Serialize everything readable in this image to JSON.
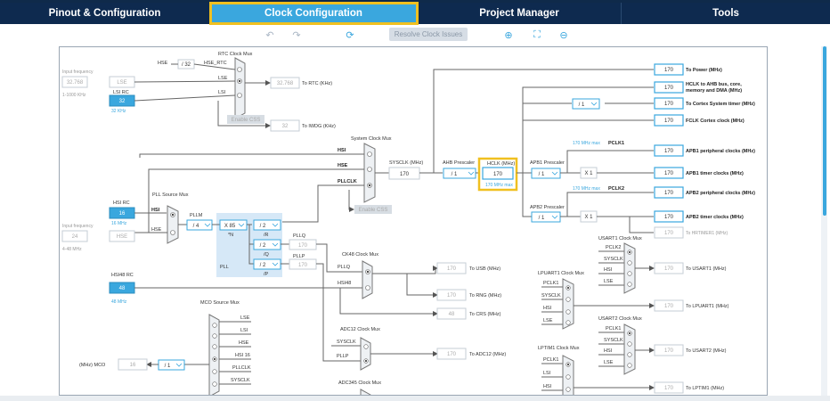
{
  "tabs": [
    "Pinout & Configuration",
    "Clock Configuration",
    "Project Manager",
    "Tools"
  ],
  "toolbar": {
    "resolve_label": "Resolve Clock Issues"
  },
  "diagram": {
    "input_freq_label": "Input frequency",
    "lse_value": "32.768",
    "lse_range": "1-1000 KHz",
    "lse_label": "LSE",
    "lsi_rc_label": "LSI RC",
    "lsi_value": "32",
    "lsi_unit": "32 KHz",
    "hse_label": "HSE",
    "div32": "/ 32",
    "hse_rtc": "HSE_RTC",
    "rtc_mux": "RTC Clock Mux",
    "lse_line": "LSE",
    "lsi_line": "LSI",
    "rtc_value": "32.768",
    "to_rtc": "To RTC (KHz)",
    "enable_css": "Enable CSS",
    "iwdg_value": "32",
    "to_iwdg": "To IWDG (KHz)",
    "sys_mux": "System Clock Mux",
    "hsi": "HSI",
    "hse": "HSE",
    "pllclk": "PLLCLK",
    "sysclk_label": "SYSCLK (MHz)",
    "sysclk_value": "170",
    "ahb_label": "AHB Prescaler",
    "ahb_value": "/ 1",
    "hclk_label": "HCLK (MHz)",
    "hclk_value": "170",
    "hclk_max": "170 MHz max",
    "enable_css2": "Enable CSS",
    "hsi_rc_label": "HSI RC",
    "hsi_value": "16",
    "hsi_unit": "16 MHz",
    "pll_src_mux": "PLL Source Mux",
    "pllm_label": "PLLM",
    "pllm_value": "/ 4",
    "x85": "X 85",
    "n_label": "*N",
    "pll_label": "PLL",
    "div2a": "/ 2",
    "r_label": "/R",
    "div2b": "/ 2",
    "q_label": "/Q",
    "div2c": "/ 2",
    "p_label": "/P",
    "pllq_label": "PLLQ",
    "pllq_value": "170",
    "pllp_label": "PLLP",
    "pllp_value": "170",
    "hse_input_freq": "Input frequency",
    "hse_value": "24",
    "hse_range": "4-48 MHz",
    "hse_box": "HSE",
    "hsi48_rc": "HSI48 RC",
    "hsi48_value": "48",
    "hsi48_unit": "48 MHz",
    "ck48_mux": "CK48 Clock Mux",
    "pllq_in": "PLLQ",
    "hsi48_in": "HSI48",
    "usb_value": "170",
    "to_usb": "To USB (MHz)",
    "rng_value": "170",
    "to_rng": "To RNG (MHz)",
    "crs_value": "48",
    "to_crs": "To CRS (MHz)",
    "mco_mux": "MCO Source Mux",
    "mco_lse": "LSE",
    "mco_lsi": "LSI",
    "mco_hse": "HSE",
    "mco_hsi16": "HSI 16",
    "mco_pllclk": "PLLCLK",
    "mco_sysclk": "SYSCLK",
    "mco_label": "(MHz) MCO",
    "mco_value": "16",
    "mco_div": "/ 1",
    "adc12_mux": "ADC12 Clock Mux",
    "adc_sysclk": "SYSCLK",
    "adc_pllp": "PLLP",
    "adc12_value": "170",
    "to_adc12": "To ADC12 (MHz)",
    "adc345_mux": "ADC345 Clock Mux",
    "to_power_value": "170",
    "to_power": "To Power (MHz)",
    "hclk_ahb_value": "170",
    "hclk_ahb": "HCLK to AHB bus, core,",
    "hclk_ahb2": "memory and DMA (MHz)",
    "systimer_div": "/ 1",
    "systimer_value": "170",
    "to_systimer": "To Cortex System timer (MHz)",
    "fclk_value": "170",
    "fclk": "FCLK Cortex clock (MHz)",
    "apb1_label": "APB1 Prescaler",
    "apb1_div": "/ 1",
    "apb1_max": "170 MHz max",
    "pclk1": "PCLK1",
    "apb1_periph_value": "170",
    "apb1_periph": "APB1 peripheral clocks (MHz)",
    "x1a": "X 1",
    "apb1_timer_value": "170",
    "apb1_timer": "APB1 timer clocks (MHz)",
    "apb2_max": "170 MHz max",
    "pclk2": "PCLK2",
    "apb2_periph_value": "170",
    "apb2_periph": "APB2 peripheral clocks (MHz)",
    "apb2_label": "APB2 Prescaler",
    "apb2_div": "/ 1",
    "x1b": "X 1",
    "apb2_timer_value": "170",
    "apb2_timer": "APB2 timer clocks (MHz)",
    "hrtim_value": "170",
    "to_hrtim": "To HRTIMER1 (MHz)",
    "usart1_mux": "USART1 Clock Mux",
    "u1_pclk2": "PCLK2",
    "u1_sysclk": "SYSCLK",
    "u1_hsi": "HSI",
    "u1_lse": "LSE",
    "usart1_value": "170",
    "to_usart1": "To USART1 (MHz)",
    "lpuart1_mux": "LPUART1 Clock Mux",
    "lp_pclk1": "PCLK1",
    "lp_sysclk": "SYSCLK",
    "lp_hsi": "HSI",
    "lp_lse": "LSE",
    "lpuart1_value": "170",
    "to_lpuart1": "To LPUART1 (MHz)",
    "usart2_mux": "USART2 Clock Mux",
    "u2_pclk1": "PCLK1",
    "u2_sysclk": "SYSCLK",
    "u2_hsi": "HSI",
    "u2_lse": "LSE",
    "usart2_value": "170",
    "to_usart2": "To USART2 (MHz)",
    "lptim1_mux": "LPTIM1 Clock Mux",
    "lt_pclk1": "PCLK1",
    "lt_lsi": "LSI",
    "lt_hsi": "HSI",
    "lptim1_value": "170",
    "to_lptim1": "To LPTIM1 (MHz)"
  },
  "colors": {
    "accent": "#3aa7de",
    "nav": "#0e2a4f",
    "highlight": "#f0c020",
    "pll_bg": "#d6e8f7"
  }
}
